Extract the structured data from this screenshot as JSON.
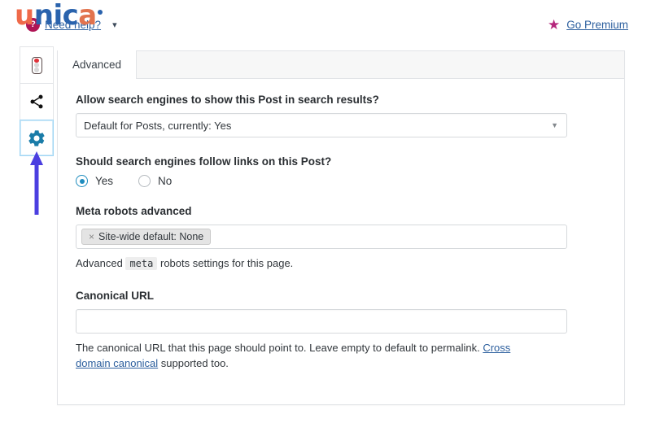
{
  "topbar": {
    "logo": {
      "name": "unica",
      "letters": [
        "u",
        "n",
        "i",
        "c",
        "a"
      ],
      "colors": {
        "primary": "#2a63ad",
        "accent": "#ef6a4a"
      }
    },
    "need_help": {
      "label": "Need help?",
      "icon": "question-mark-icon",
      "icon_color": "#b01455",
      "caret": "⌄"
    },
    "go_premium": {
      "label": "Go Premium",
      "icon": "star-icon",
      "icon_color": "#b5277c",
      "star_glyph": "★"
    }
  },
  "sidebar": {
    "tabs": [
      {
        "name": "seo-score-tab",
        "icon": "traffic-light-icon",
        "active": false
      },
      {
        "name": "social-share-tab",
        "icon": "share-icon",
        "active": false
      },
      {
        "name": "advanced-settings-tab",
        "icon": "gear-icon",
        "active": true,
        "icon_color": "#1a7ca8"
      }
    ],
    "pointer": {
      "name": "arrow-annotation",
      "color": "#4b3fe0",
      "direction": "up"
    }
  },
  "panel": {
    "tabs": [
      {
        "label": "Advanced",
        "active": true
      }
    ],
    "fields": {
      "allow_search": {
        "label": "Allow search engines to show this Post in search results?",
        "selected": "Default for Posts, currently: Yes",
        "caret": "▾"
      },
      "follow_links": {
        "label": "Should search engines follow links on this Post?",
        "options": [
          {
            "label": "Yes",
            "checked": true
          },
          {
            "label": "No",
            "checked": false
          }
        ]
      },
      "meta_robots_advanced": {
        "label": "Meta robots advanced",
        "token": {
          "remove": "×",
          "label": "Site-wide default: None"
        },
        "help_before": "Advanced",
        "help_code": "meta",
        "help_after": "robots settings for this page."
      },
      "canonical_url": {
        "label": "Canonical URL",
        "value": "",
        "placeholder": "",
        "help_before": "The canonical URL that this page should point to. Leave empty to default to permalink. ",
        "help_link": "Cross domain canonical",
        "help_after": " supported too."
      }
    }
  }
}
